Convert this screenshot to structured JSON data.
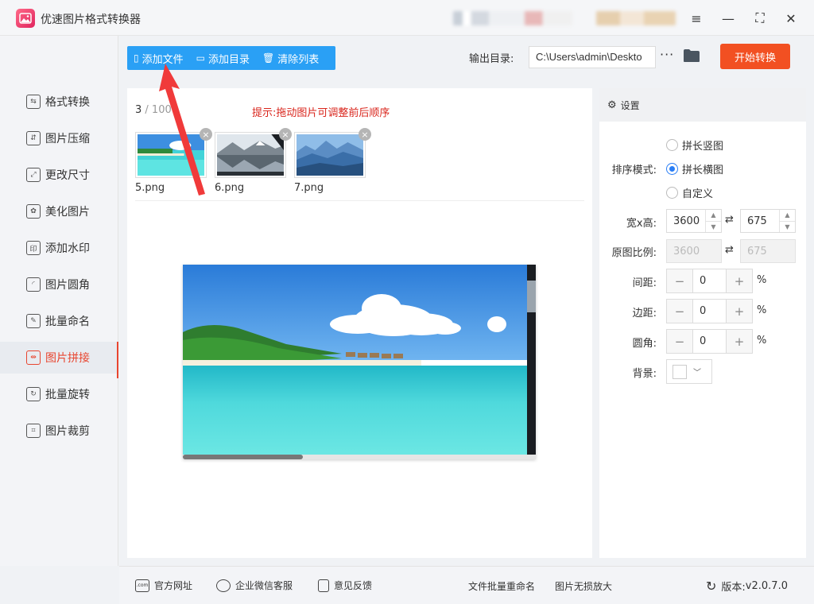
{
  "app": {
    "title": "优速图片格式转换器"
  },
  "window_controls": {
    "menu": "≡",
    "minimize": "—",
    "maximize": "⛶",
    "close": "✕"
  },
  "toolbar": {
    "add_file": "添加文件",
    "add_dir": "添加目录",
    "clear_list": "清除列表",
    "output_label": "输出目录:",
    "output_path": "C:\\Users\\admin\\Deskto",
    "more": "···",
    "start": "开始转换"
  },
  "sidebar": {
    "items": [
      {
        "label": "格式转换",
        "icon": "format-convert-icon",
        "glyph": "⇆"
      },
      {
        "label": "图片压缩",
        "icon": "compress-icon",
        "glyph": "⇵"
      },
      {
        "label": "更改尺寸",
        "icon": "resize-icon",
        "glyph": "⤢"
      },
      {
        "label": "美化图片",
        "icon": "beautify-icon",
        "glyph": "✿"
      },
      {
        "label": "添加水印",
        "icon": "watermark-icon",
        "glyph": "印"
      },
      {
        "label": "图片圆角",
        "icon": "round-corner-icon",
        "glyph": "◜"
      },
      {
        "label": "批量命名",
        "icon": "rename-icon",
        "glyph": "✎"
      },
      {
        "label": "图片拼接",
        "icon": "stitch-icon",
        "glyph": "⇹",
        "active": true
      },
      {
        "label": "批量旋转",
        "icon": "rotate-icon",
        "glyph": "↻"
      },
      {
        "label": "图片裁剪",
        "icon": "crop-icon",
        "glyph": "⌗"
      }
    ]
  },
  "main": {
    "count": "3",
    "count_total": " / 100",
    "hint": "提示:拖动图片可调整前后顺序",
    "thumbs": [
      {
        "name": "5.png"
      },
      {
        "name": "6.png"
      },
      {
        "name": "7.png"
      }
    ],
    "close_glyph": "×"
  },
  "settings": {
    "title": "设置",
    "sort_label": "排序模式:",
    "sort_options": [
      {
        "label": "拼长竖图",
        "checked": false
      },
      {
        "label": "拼长横图",
        "checked": true
      },
      {
        "label": "自定义",
        "checked": false
      }
    ],
    "size_label": "宽x高:",
    "width": "3600",
    "height": "675",
    "ratio_label": "原图比例:",
    "ratio_w": "3600",
    "ratio_h": "675",
    "gap_label": "间距:",
    "gap": "0",
    "margin_label": "边距:",
    "margin": "0",
    "radius_label": "圆角:",
    "radius": "0",
    "bg_label": "背景:",
    "bg_color": "#ffffff",
    "percent": "%",
    "minus": "−",
    "plus": "+",
    "swap": "⇄"
  },
  "footer": {
    "official_site": "官方网址",
    "wechat_service": "企业微信客服",
    "feedback": "意见反馈",
    "batch_rename": "文件批量重命名",
    "lossless_zoom": "图片无损放大",
    "version_label": "版本:",
    "version": "v2.0.7.0"
  },
  "colors": {
    "accent_blue": "#2aa0f5",
    "start_orange": "#f25022",
    "active_red": "#e8452f",
    "hint_red": "#d9251c",
    "arrow_red": "#f03a3a"
  }
}
